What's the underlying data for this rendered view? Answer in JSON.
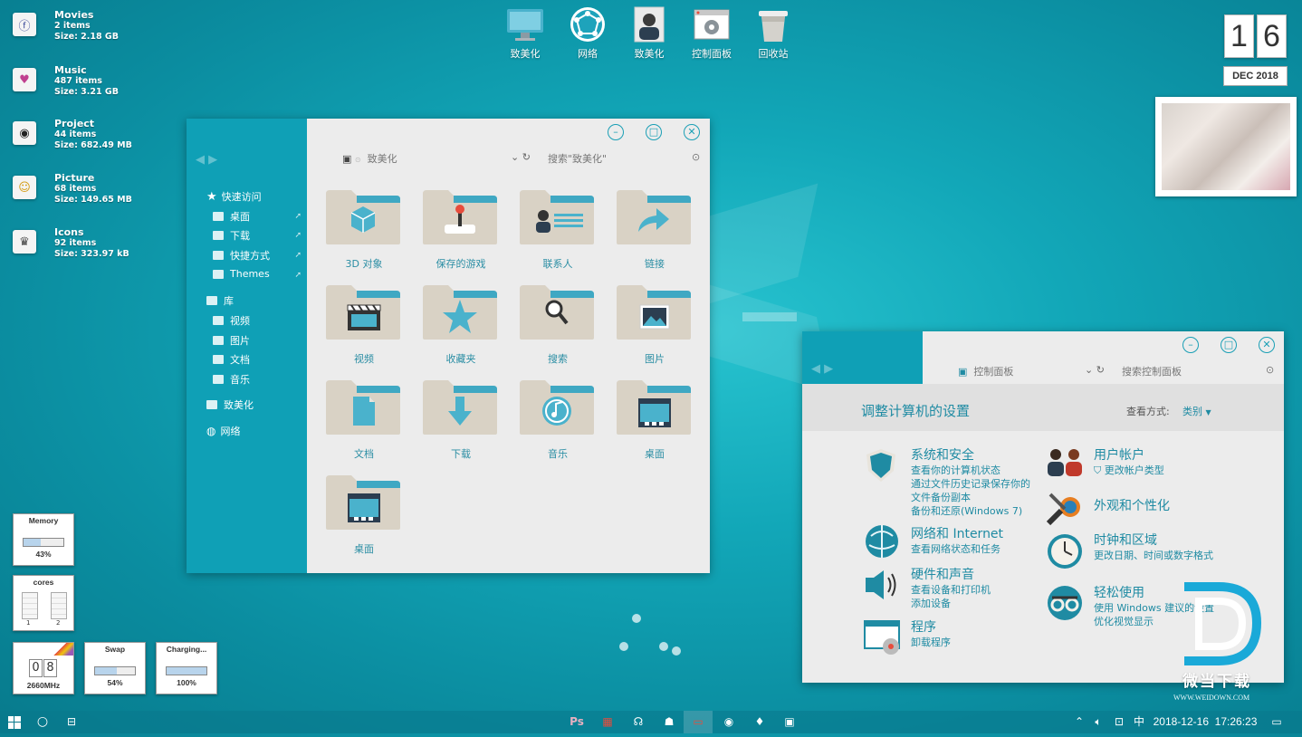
{
  "desktop_drives": [
    {
      "name": "Movies",
      "count": "2 items",
      "size": "Size: 2.18 GB",
      "icon": "movie-icon"
    },
    {
      "name": "Music",
      "count": "487 items",
      "size": "Size: 3.21 GB",
      "icon": "music-icon"
    },
    {
      "name": "Project",
      "count": "44 items",
      "size": "Size: 682.49 MB",
      "icon": "project-icon"
    },
    {
      "name": "Picture",
      "count": "68 items",
      "size": "Size: 149.65 MB",
      "icon": "picture-icon"
    },
    {
      "name": "Icons",
      "count": "92 items",
      "size": "Size: 323.97 kB",
      "icon": "icons-icon"
    }
  ],
  "top_icons": [
    {
      "label": "致美化",
      "icon": "monitor-icon"
    },
    {
      "label": "网络",
      "icon": "network-globe-icon"
    },
    {
      "label": "致美化",
      "icon": "user-folder-icon"
    },
    {
      "label": "控制面板",
      "icon": "control-panel-icon"
    },
    {
      "label": "回收站",
      "icon": "recycle-bin-icon"
    }
  ],
  "clock": {
    "digit1": "1",
    "digit2": "6",
    "date": "DEC 2018"
  },
  "explorer": {
    "location": "致美化",
    "search_placeholder": "搜索\"致美化\"",
    "nav": {
      "quick_access": "快速访问",
      "items": [
        "桌面",
        "下载",
        "快捷方式",
        "Themes"
      ],
      "library": "库",
      "library_items": [
        "视频",
        "图片",
        "文档",
        "音乐"
      ],
      "pc": "致美化",
      "network": "网络"
    },
    "folders": [
      "3D 对象",
      "保存的游戏",
      "联系人",
      "链接",
      "视频",
      "收藏夹",
      "搜索",
      "图片",
      "文档",
      "下载",
      "音乐",
      "桌面",
      "桌面"
    ]
  },
  "control_panel": {
    "location": "控制面板",
    "search_placeholder": "搜索控制面板",
    "heading": "调整计算机的设置",
    "view_by_label": "查看方式:",
    "view_by_value": "类别",
    "left_items": [
      {
        "title": "系统和安全",
        "subs": [
          "查看你的计算机状态",
          "通过文件历史记录保存你的文件备份副本",
          "备份和还原(Windows 7)"
        ]
      },
      {
        "title": "网络和 Internet",
        "subs": [
          "查看网络状态和任务"
        ]
      },
      {
        "title": "硬件和声音",
        "subs": [
          "查看设备和打印机",
          "添加设备"
        ]
      },
      {
        "title": "程序",
        "subs": [
          "卸载程序"
        ]
      }
    ],
    "right_items": [
      {
        "title": "用户帐户",
        "subs": [
          "更改帐户类型"
        ]
      },
      {
        "title": "外观和个性化",
        "subs": []
      },
      {
        "title": "时钟和区域",
        "subs": [
          "更改日期、时间或数字格式"
        ]
      },
      {
        "title": "轻松使用",
        "subs": [
          "使用 Windows 建议的设置",
          "优化视觉显示"
        ]
      }
    ]
  },
  "gadgets": {
    "memory": {
      "title": "Memory",
      "value": "43%",
      "fill": 0.43
    },
    "cores": {
      "title": "cores",
      "labels": [
        "1",
        "2"
      ]
    },
    "cpu": {
      "digits": [
        "0",
        "8"
      ],
      "freq": "2660MHz"
    },
    "swap": {
      "title": "Swap",
      "value": "54%",
      "fill": 0.54
    },
    "battery": {
      "title": "Charging...",
      "value": "100%",
      "fill": 1.0
    }
  },
  "watermark": {
    "text": "微当下载",
    "url": "WWW.WEIDOWN.COM"
  },
  "taskbar": {
    "apps": [
      "Ps",
      "app-grid-icon",
      "headphones-icon",
      "people-icon",
      "monitor-icon",
      "chrome-icon",
      "drop-icon",
      "window-icon"
    ],
    "tray": {
      "ime": "中",
      "datetime": "2018-12-16  17:26:23"
    }
  },
  "colors": {
    "accent": "#0fa0b6",
    "text_accent": "#1f8ba3"
  }
}
